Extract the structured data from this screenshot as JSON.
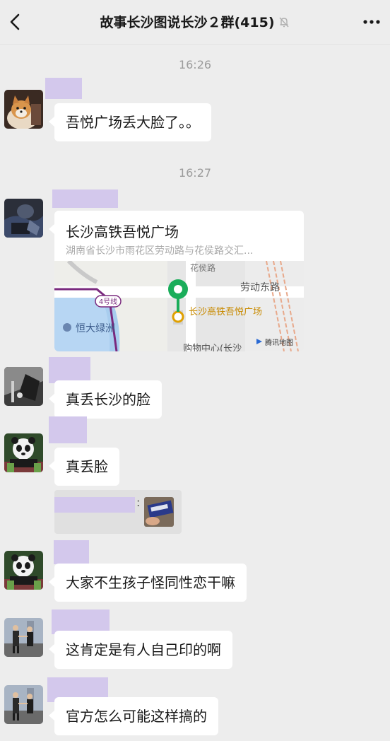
{
  "header": {
    "title": "故事长沙图说长沙２群(415)"
  },
  "timestamps": [
    "16:26",
    "16:27"
  ],
  "messages": {
    "m1": "吾悦广场丢大脸了。。",
    "m3": "真丢长沙的脸",
    "m4": "真丢脸",
    "m5": "大家不生孩子怪同性恋干嘛",
    "m6": "这肯定是有人自己印的啊",
    "m7": "官方怎么可能这样搞的"
  },
  "location": {
    "title": "长沙高铁吾悦广场",
    "address": "湖南省长沙市雨花区劳动路与花侯路交汇...",
    "map_labels": {
      "road_east": "劳动东路",
      "road_top": "花侯路",
      "line": "4号线",
      "poi_left": "恒大绿洲",
      "poi_main": "长沙高铁吾悦广场",
      "poi_bottom": "购物中心(长沙",
      "provider": "腾讯地图"
    }
  },
  "quote": {
    "colon": ":"
  },
  "colors": {
    "background": "#ededed",
    "bubble": "#ffffff",
    "redaction": "#d3c8ec",
    "pin": "#1aad5a"
  }
}
